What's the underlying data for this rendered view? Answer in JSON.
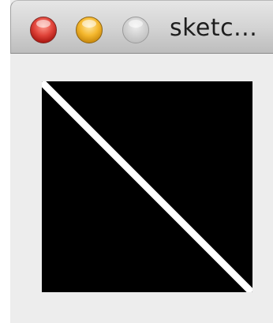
{
  "window": {
    "title": "sketc...",
    "controls": {
      "close_icon": "close-dot",
      "minimize_icon": "minimize-dot",
      "zoom_icon": "zoom-dot-disabled"
    }
  },
  "sketch": {
    "background_color": "#000000",
    "stroke_color": "#ffffff",
    "shape": "diagonal-line"
  }
}
